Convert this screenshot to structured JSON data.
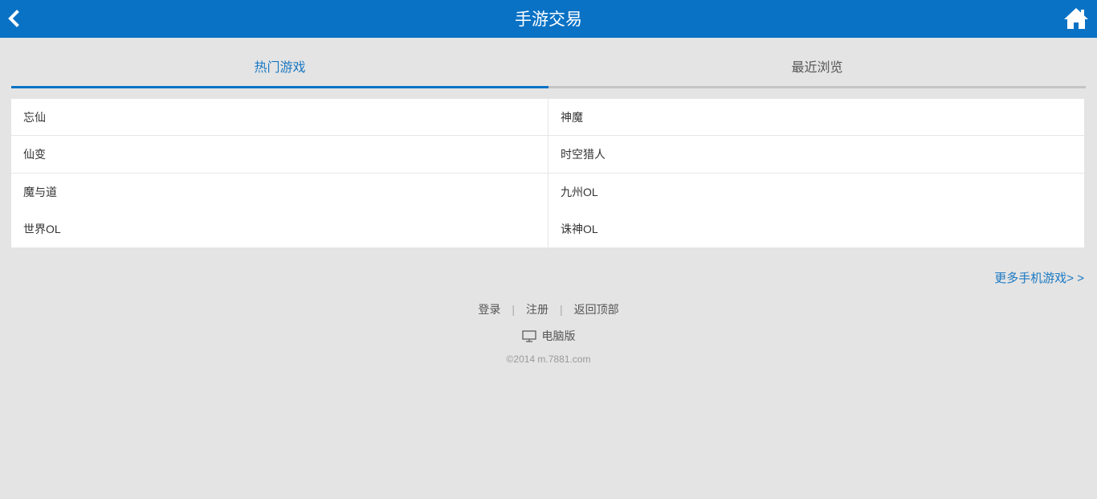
{
  "header": {
    "title": "手游交易",
    "back_icon": "back-chevron-icon",
    "home_icon": "home-icon"
  },
  "tabs": [
    {
      "label": "热门游戏",
      "active": true
    },
    {
      "label": "最近浏览",
      "active": false
    }
  ],
  "games": {
    "left": [
      "忘仙",
      "仙变",
      "魔与道",
      "世界OL"
    ],
    "right": [
      "神魔",
      "时空猎人",
      "九州OL",
      "诛神OL"
    ]
  },
  "more_link": "更多手机游戏> >",
  "footer": {
    "login": "登录",
    "register": "注册",
    "back_to_top": "返回顶部",
    "separator": "|",
    "pc_version": "电脑版",
    "pc_icon": "monitor-icon",
    "copyright": "©2014 m.7881.com"
  },
  "colors": {
    "header_bg": "#0a72c5",
    "accent": "#1a78c2",
    "page_bg": "#e4e4e4"
  }
}
